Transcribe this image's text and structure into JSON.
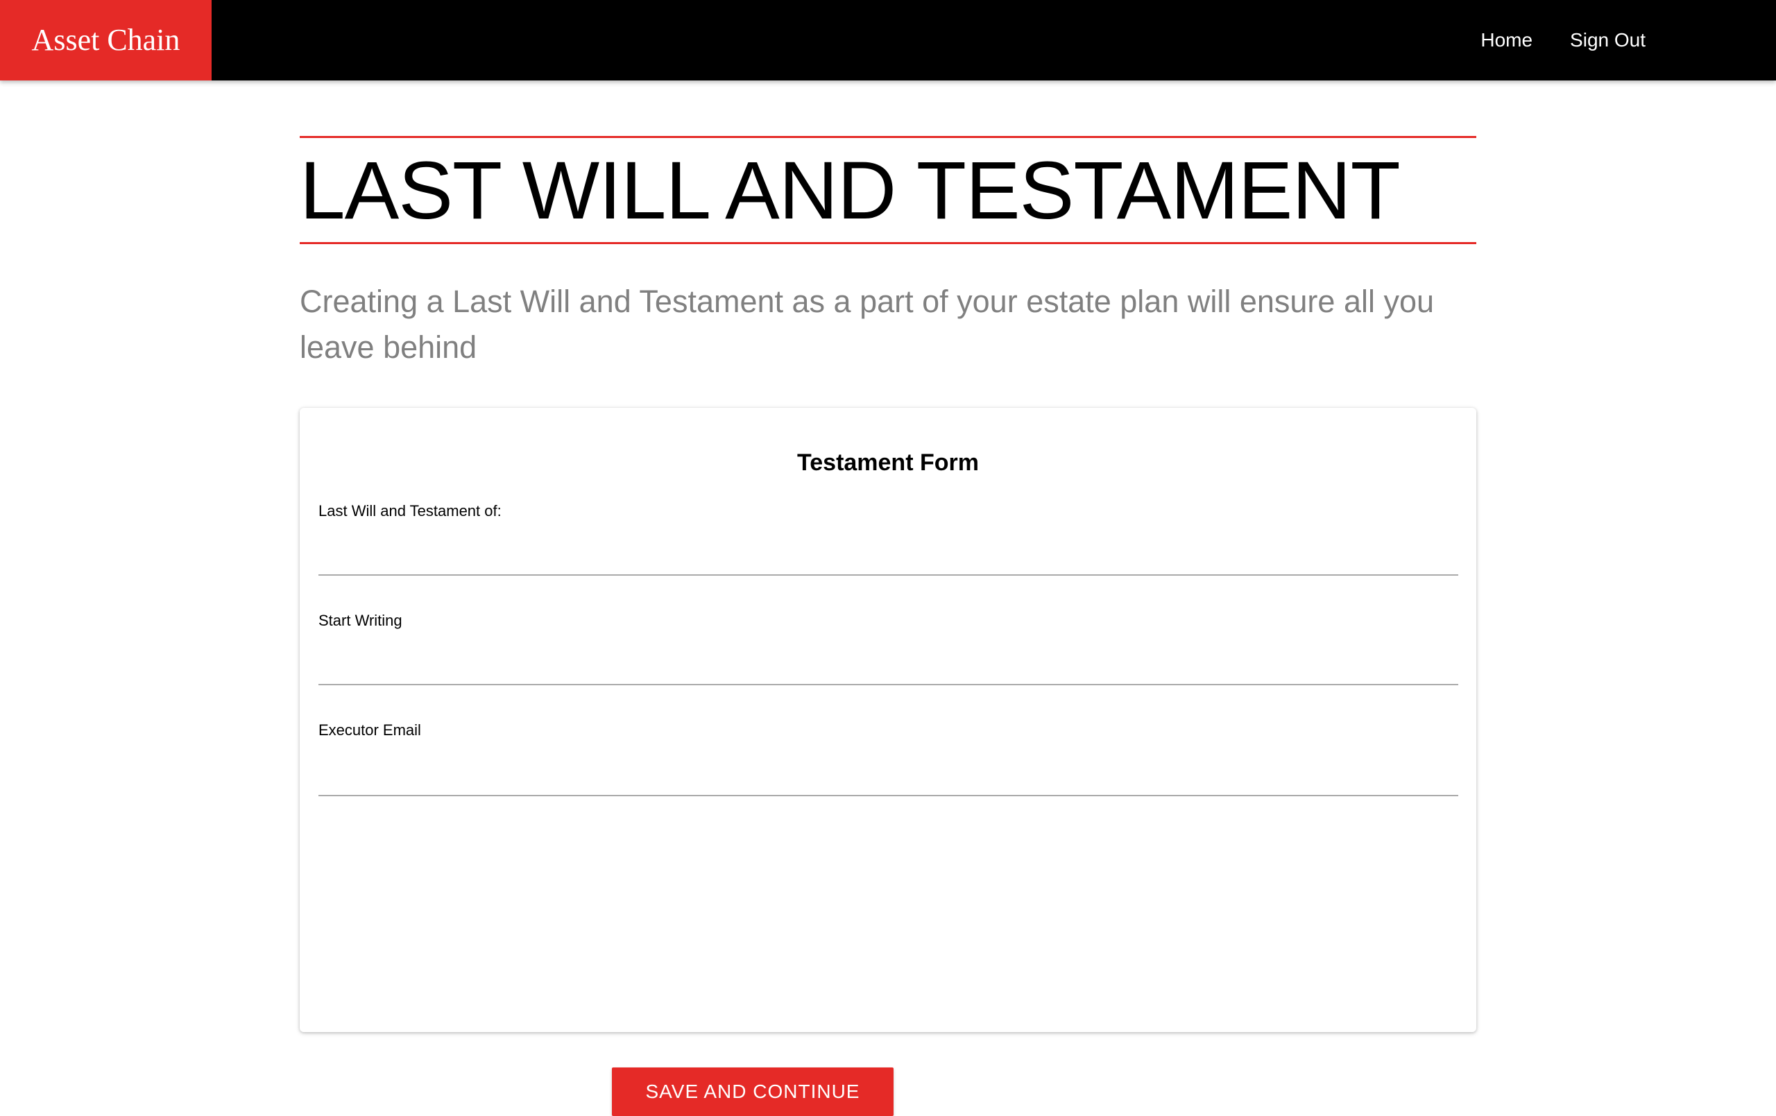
{
  "header": {
    "brand": "Asset Chain",
    "nav": [
      "Home",
      "Sign Out"
    ]
  },
  "page": {
    "title": "LAST WILL AND TESTAMENT",
    "subtitle": "Creating a Last Will and Testament as a part of your estate plan will ensure all you leave behind"
  },
  "form": {
    "title": "Testament Form",
    "fields": [
      {
        "label": "Last Will and Testament of:",
        "value": ""
      },
      {
        "label": "Start Writing",
        "value": ""
      },
      {
        "label": "Executor Email",
        "value": ""
      }
    ],
    "submit_label": "SAVE AND CONTINUE"
  },
  "colors": {
    "accent": "#e52a27",
    "header_bg": "#000000",
    "subtitle_text": "#808080"
  }
}
